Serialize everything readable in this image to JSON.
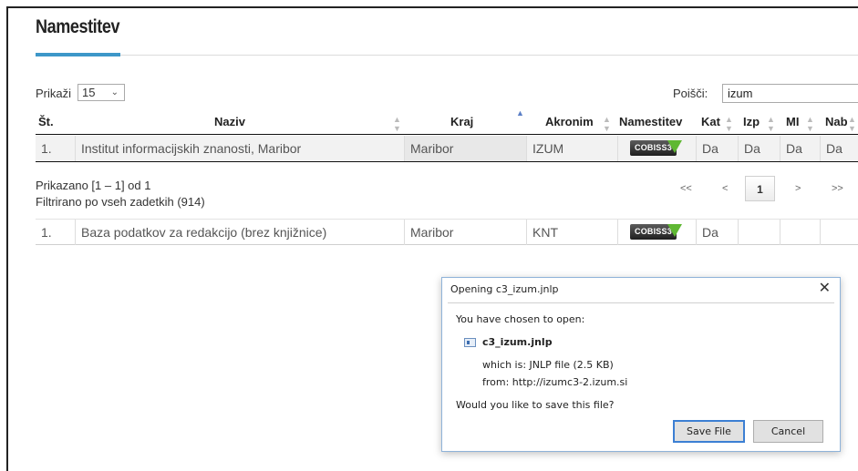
{
  "page": {
    "title": "Namestitev"
  },
  "controls": {
    "show_label": "Prikaži",
    "show_value": "15",
    "search_label": "Poišči:",
    "search_value": "izum"
  },
  "table": {
    "headers": [
      "Št.",
      "Naziv",
      "Kraj",
      "Akronim",
      "Namestitev",
      "Kat",
      "Izp",
      "MI",
      "Nab"
    ],
    "rows": [
      {
        "num": "1.",
        "naziv": "Institut informacijskih znanosti, Maribor",
        "kraj": "Maribor",
        "akronim": "IZUM",
        "badge": "COBISS3",
        "kat": "Da",
        "izp": "Da",
        "mi": "Da",
        "nab": "Da"
      }
    ]
  },
  "info": {
    "showing": "Prikazano [1 – 1] od 1",
    "filtered": "Filtrirano po vseh zadetkih (914)"
  },
  "pagination": {
    "first": "<<",
    "prev": "<",
    "current": "1",
    "next": ">",
    "last": ">>"
  },
  "extra_row": {
    "num": "1.",
    "naziv": "Baza podatkov za redakcijo (brez knjižnice)",
    "kraj": "Maribor",
    "akronim": "KNT",
    "badge": "COBISS3",
    "kat": "Da"
  },
  "dialog": {
    "title": "Opening c3_izum.jnlp",
    "close": "✕",
    "chosen": "You have chosen to open:",
    "filename": "c3_izum.jnlp",
    "which_is": "which is:  JNLP file (2.5 KB)",
    "from": "from:  http://izumc3-2.izum.si",
    "question": "Would you like to save this file?",
    "save_label": "Save File",
    "cancel_label": "Cancel"
  },
  "colors": {
    "accent": "#3d97c8",
    "cobiss_green": "#5fb833",
    "dialog_border": "#8fb3d9"
  }
}
